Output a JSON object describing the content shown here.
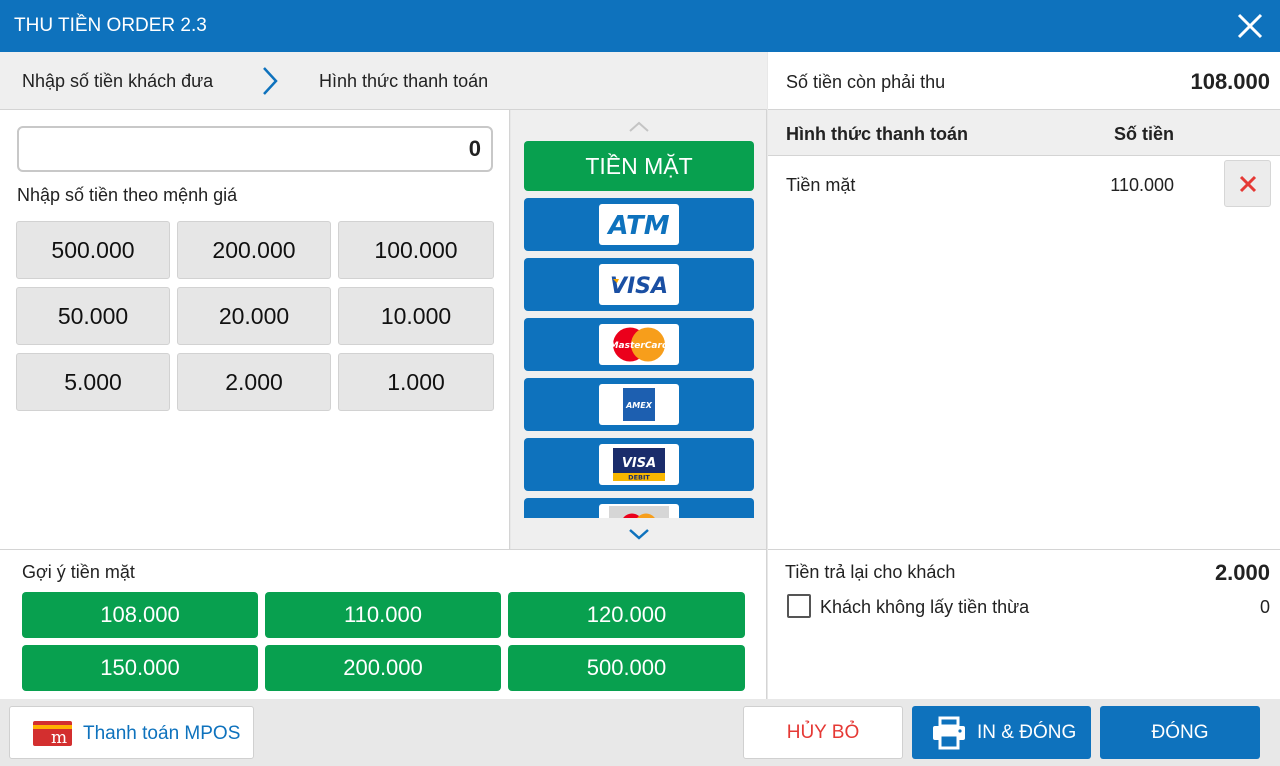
{
  "window": {
    "title": "THU TIỀN ORDER 2.3"
  },
  "breadcrumb": {
    "step1": "Nhập số tiền khách đưa",
    "step2": "Hình thức thanh toán"
  },
  "amount_input": {
    "value": "0"
  },
  "denominations": {
    "label": "Nhập số tiền theo mệnh giá",
    "items": [
      "500.000",
      "200.000",
      "100.000",
      "50.000",
      "20.000",
      "10.000",
      "5.000",
      "2.000",
      "1.000"
    ]
  },
  "payment_methods": {
    "cash_label": "TIỀN MẶT",
    "cards": [
      {
        "name": "atm-card",
        "text": "ATM"
      },
      {
        "name": "visa-card",
        "text": "VISA"
      },
      {
        "name": "mastercard-card",
        "text": "MasterCard"
      },
      {
        "name": "amex-card",
        "text": "AMEX"
      },
      {
        "name": "visa-debit-card",
        "text": "VISA",
        "sub": "DEBIT"
      },
      {
        "name": "maestro-card",
        "text": ""
      }
    ]
  },
  "remaining": {
    "label": "Số tiền còn phải thu",
    "value": "108.000"
  },
  "payment_table": {
    "headers": [
      "Hình thức thanh toán",
      "Số tiền"
    ],
    "rows": [
      {
        "method": "Tiền mặt",
        "amount": "110.000"
      }
    ]
  },
  "suggestions": {
    "label": "Gợi ý tiền mặt",
    "items": [
      "108.000",
      "110.000",
      "120.000",
      "150.000",
      "200.000",
      "500.000"
    ]
  },
  "change": {
    "label": "Tiền trả lại cho khách",
    "value": "2.000",
    "checkbox_label": "Khách không lấy tiền thừa",
    "checkbox_value": "0"
  },
  "footer": {
    "mpos_label": "Thanh toán MPOS",
    "mpos_icon_letter": "m",
    "cancel_label": "HỦY BỎ",
    "print_label": "IN & ĐÓNG",
    "close_label": "ĐÓNG"
  },
  "colors": {
    "primary": "#0e72bd",
    "success": "#08a04f",
    "danger": "#e53935"
  }
}
